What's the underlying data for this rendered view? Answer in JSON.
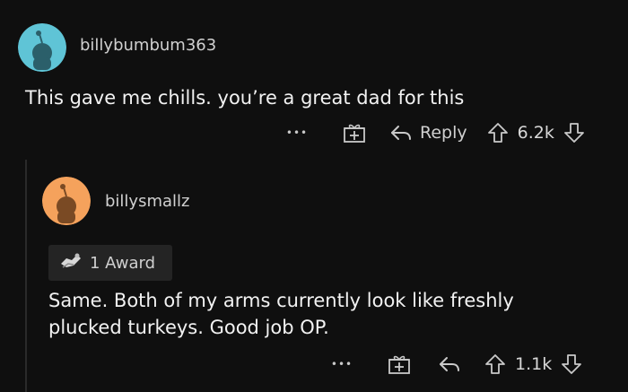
{
  "comment1": {
    "username": "billybumbum363",
    "body": "This gave me chills. you’re a great dad for this",
    "more_label": "•••",
    "reply_label": "Reply",
    "score": "6.2k",
    "avatar_color": "#5fc4d6"
  },
  "comment2": {
    "username": "billysmallz",
    "award_label": "1 Award",
    "body_line1": "Same. Both of my arms currently look like freshly",
    "body_line2": "plucked turkeys. Good job OP.",
    "more_label": "•••",
    "score": "1.1k",
    "avatar_color": "#f5a25c"
  },
  "icons": {
    "more": "more-options-icon",
    "award": "gift-icon",
    "reply": "reply-arrow-icon",
    "upvote": "upvote-arrow-icon",
    "downvote": "downvote-arrow-icon"
  }
}
